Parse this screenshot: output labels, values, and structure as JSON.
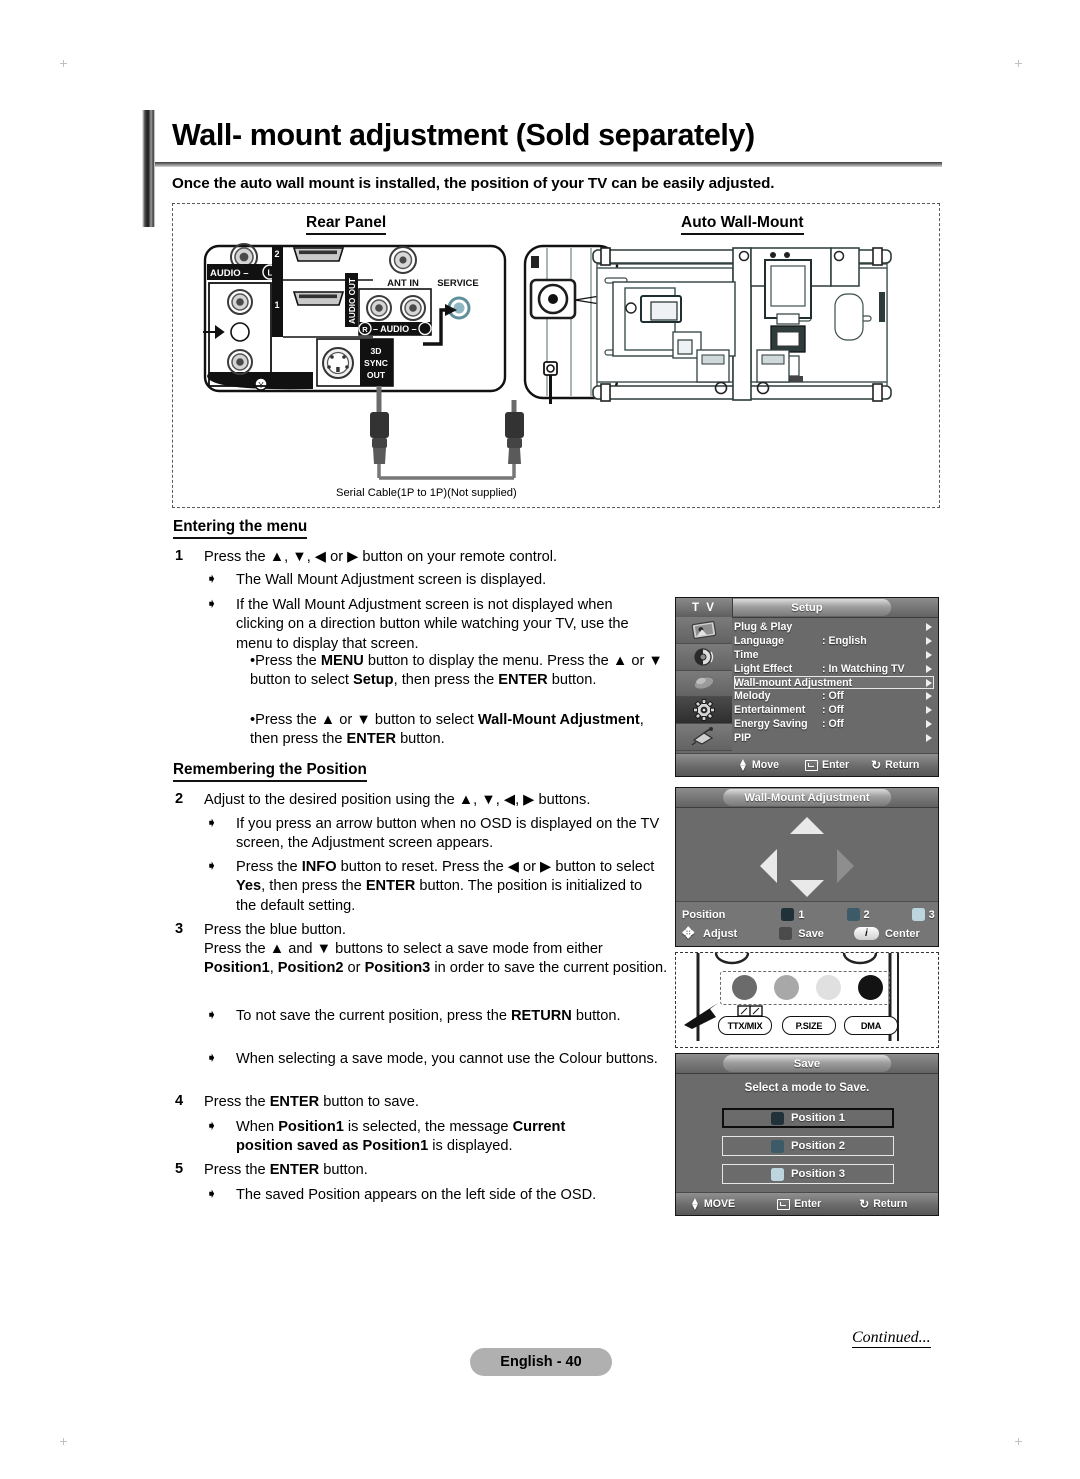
{
  "document": {
    "title": "Wall- mount adjustment (Sold separately)",
    "subtitle": "Once the auto wall mount is installed, the position of your TV can be easily adjusted.",
    "page_badge": "English - 40",
    "continued": "Continued..."
  },
  "diagram": {
    "rear_panel_label": "Rear Panel",
    "auto_wall_mount_label": "Auto Wall-Mount",
    "cable_caption": "Serial Cable(1P to 1P)(Not supplied)",
    "rear_panel_ports": {
      "audio_l": "AUDIO",
      "audio_l_mark": "L",
      "hdmi_2": "2",
      "hdmi_1": "1",
      "audio_out": "AUDIO OUT",
      "ant_in": "ANT IN",
      "service": "SERVICE",
      "audio_r": "R",
      "audio_dash": "- AUDIO -",
      "sync_out_line1": "3D",
      "sync_out_line2": "SYNC",
      "sync_out_line3": "OUT"
    }
  },
  "entering_menu": {
    "heading": "Entering the menu",
    "step1_num": "1",
    "step1_text": "Press the ▲, ▼, ◀ or ▶ button on your remote control.",
    "bullets": [
      "The Wall Mount Adjustment screen is displayed.",
      "If the Wall Mount Adjustment screen is not displayed when clicking on a direction button while watching your TV, use the menu to display that screen."
    ],
    "subbullet1_pre": "Press the ",
    "subbullet1_b1": "MENU",
    "subbullet1_mid": " button to display the menu. Press the ▲ or ▼ button to select ",
    "subbullet1_b2": "Setup",
    "subbullet1_mid2": ", then press the ",
    "subbullet1_b3": "ENTER",
    "subbullet1_end": " button.",
    "subbullet2_pre": "Press the ▲ or ▼ button to select ",
    "subbullet2_b1": "Wall-Mount Adjustment",
    "subbullet2_mid": ", then press the ",
    "subbullet2_b2": "ENTER",
    "subbullet2_end": " button."
  },
  "remembering": {
    "heading": "Remembering the Position",
    "step2_num": "2",
    "step2_text": "Adjust to the desired position using the ▲, ▼, ◀, ▶ buttons.",
    "step2_b1": "If you press an arrow button when no OSD is displayed on the TV screen, the Adjustment screen appears.",
    "step2_b2_pre": "Press the ",
    "step2_b2_k1": "INFO",
    "step2_b2_mid": " button to reset. Press the ◀ or ▶ button to select ",
    "step2_b2_k2": "Yes",
    "step2_b2_mid2": ", then press the ",
    "step2_b2_k3": "ENTER",
    "step2_b2_end": " button. The position is initialized to the default setting.",
    "step3_num": "3",
    "step3_line1": "Press the blue button.",
    "step3_line2_pre": "Press the ▲ and ▼ buttons to select a save mode from either ",
    "step3_k1": "Position1",
    "step3_sep1": ", ",
    "step3_k2": "Position2",
    "step3_sep2": " or ",
    "step3_k3": "Position3",
    "step3_line2_end": " in order to save the current position.",
    "step3_b1_pre": "To not save the current position, press the ",
    "step3_b1_k": "RETURN",
    "step3_b1_end": " button.",
    "step3_b2": "When selecting a save mode, you cannot use the Colour buttons.",
    "step4_num": "4",
    "step4_pre": "Press the ",
    "step4_k": "ENTER",
    "step4_end": " button to save.",
    "step4_b1_pre": "When ",
    "step4_b1_k1": "Position1",
    "step4_b1_mid": " is selected, the message ",
    "step4_b1_k2": "Current position saved as Position1",
    "step4_b1_end": " is displayed.",
    "step5_num": "5",
    "step5_pre": "Press the ",
    "step5_k": "ENTER",
    "step5_end": " button.",
    "step5_b1": "The saved Position appears on the left side of the OSD."
  },
  "osd_setup": {
    "tv_label": "T V",
    "title": "Setup",
    "rows": [
      {
        "label": "Plug & Play",
        "value": ""
      },
      {
        "label": "Language",
        "value": ": English"
      },
      {
        "label": "Time",
        "value": ""
      },
      {
        "label": "Light Effect",
        "value": ": In Watching TV"
      },
      {
        "label": "Wall-mount Adjustment",
        "value": ""
      },
      {
        "label": "Melody",
        "value": ": Off"
      },
      {
        "label": "Entertainment",
        "value": ": Off"
      },
      {
        "label": "Energy Saving",
        "value": ": Off"
      },
      {
        "label": "PIP",
        "value": ""
      }
    ],
    "highlight_index": 4,
    "footer": {
      "move": "Move",
      "enter": "Enter",
      "return": "Return"
    },
    "rail_icons": [
      "picture-icon",
      "sound-icon",
      "channel-icon",
      "setup-gear-icon",
      "input-icon"
    ],
    "rail_active_index": 3
  },
  "osd_wallmount": {
    "title": "Wall-Mount Adjustment",
    "position_label": "Position",
    "positions": [
      {
        "num": "1",
        "color": "#21313a"
      },
      {
        "num": "2",
        "color": "#3d5a68"
      },
      {
        "num": "3",
        "color": "#bcd5de"
      }
    ],
    "adjust_label": "Adjust",
    "save_label": "Save",
    "save_swatch": "#4b4b4b",
    "center_label": "Center",
    "center_glyph": "i"
  },
  "remote": {
    "dots": [
      {
        "name": "red-button",
        "color": "#6b6b6b"
      },
      {
        "name": "green-button",
        "color": "#a8a8a8"
      },
      {
        "name": "yellow-button",
        "color": "#e0e0e0"
      },
      {
        "name": "blue-button",
        "color": "#131313"
      }
    ],
    "captions": [
      "TTX/MIX",
      "P.SIZE",
      "DMA"
    ]
  },
  "osd_save": {
    "title": "Save",
    "prompt": "Select a mode to Save.",
    "options": [
      {
        "label": "Position 1",
        "color": "#21313a",
        "selected": true
      },
      {
        "label": "Position 2",
        "color": "#3d5a68",
        "selected": false
      },
      {
        "label": "Position 3",
        "color": "#bcd5de",
        "selected": false
      }
    ],
    "footer": {
      "move": "MOVE",
      "enter": "Enter",
      "return": "Return"
    }
  }
}
